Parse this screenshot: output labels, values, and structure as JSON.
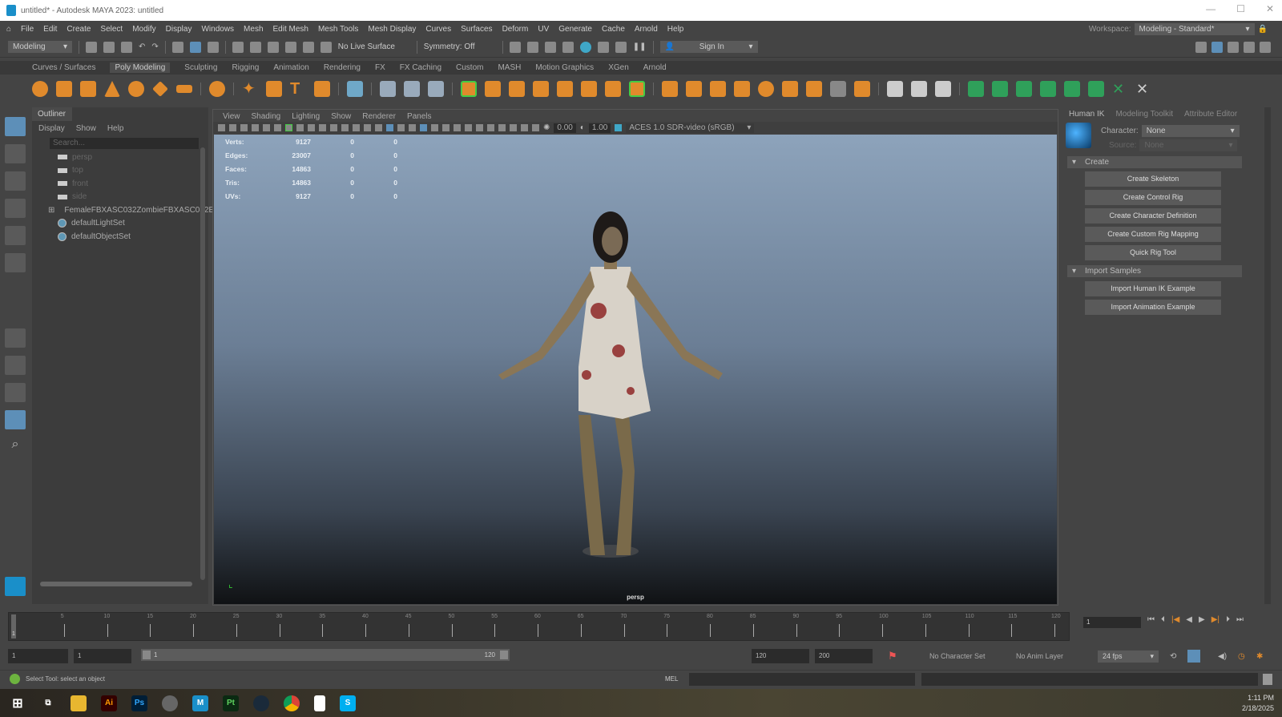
{
  "window": {
    "title": "untitled* - Autodesk MAYA 2023: untitled"
  },
  "menubar": {
    "items": [
      "File",
      "Edit",
      "Create",
      "Select",
      "Modify",
      "Display",
      "Windows",
      "Mesh",
      "Edit Mesh",
      "Mesh Tools",
      "Mesh Display",
      "Curves",
      "Surfaces",
      "Deform",
      "UV",
      "Generate",
      "Cache",
      "Arnold",
      "Help"
    ],
    "workspace_label": "Workspace:",
    "workspace_value": "Modeling - Standard*"
  },
  "statusline": {
    "mode": "Modeling",
    "live_surface": "No Live Surface",
    "symmetry": "Symmetry: Off",
    "sign_in": "Sign In"
  },
  "shelf": {
    "tabs": [
      "Curves / Surfaces",
      "Poly Modeling",
      "Sculpting",
      "Rigging",
      "Animation",
      "Rendering",
      "FX",
      "FX Caching",
      "Custom",
      "MASH",
      "Motion Graphics",
      "XGen",
      "Arnold"
    ],
    "active_tab": "Poly Modeling"
  },
  "outliner": {
    "tab": "Outliner",
    "menu": [
      "Display",
      "Show",
      "Help"
    ],
    "search_placeholder": "Search...",
    "items": [
      {
        "label": "persp",
        "type": "camera"
      },
      {
        "label": "top",
        "type": "camera"
      },
      {
        "label": "front",
        "type": "camera"
      },
      {
        "label": "side",
        "type": "camera"
      },
      {
        "label": "FemaleFBXASC032ZombieFBXASC032E",
        "type": "mesh"
      },
      {
        "label": "defaultLightSet",
        "type": "set"
      },
      {
        "label": "defaultObjectSet",
        "type": "set"
      }
    ]
  },
  "viewport": {
    "menu": [
      "View",
      "Shading",
      "Lighting",
      "Show",
      "Renderer",
      "Panels"
    ],
    "exposure": "0.00",
    "gamma": "1.00",
    "color_space": "ACES 1.0 SDR-video (sRGB)",
    "camera": "persp",
    "hud": [
      {
        "label": "Verts:",
        "value": "9127",
        "sel": "0",
        "comp": "0"
      },
      {
        "label": "Edges:",
        "value": "23007",
        "sel": "0",
        "comp": "0"
      },
      {
        "label": "Faces:",
        "value": "14863",
        "sel": "0",
        "comp": "0"
      },
      {
        "label": "Tris:",
        "value": "14863",
        "sel": "0",
        "comp": "0"
      },
      {
        "label": "UVs:",
        "value": "9127",
        "sel": "0",
        "comp": "0"
      }
    ]
  },
  "right_panel": {
    "tabs": [
      "Human IK",
      "Modeling Toolkit",
      "Attribute Editor"
    ],
    "character_label": "Character:",
    "character_value": "None",
    "source_label": "Source:",
    "source_value": "None",
    "create_section": "Create",
    "create_buttons": [
      "Create Skeleton",
      "Create Control Rig",
      "Create Character Definition",
      "Create Custom Rig Mapping",
      "Quick Rig Tool"
    ],
    "import_section": "Import Samples",
    "import_buttons": [
      "Import Human IK Example",
      "Import Animation Example"
    ]
  },
  "timeline": {
    "ticks": [
      "5",
      "10",
      "15",
      "20",
      "25",
      "30",
      "35",
      "40",
      "45",
      "50",
      "55",
      "60",
      "65",
      "70",
      "75",
      "80",
      "85",
      "90",
      "95",
      "100",
      "105",
      "110",
      "115",
      "120"
    ],
    "current_frame": "1",
    "current_marker": "1"
  },
  "range": {
    "start": "1",
    "anim_start": "1",
    "range_start": "1",
    "range_end": "120",
    "end": "120",
    "anim_end": "200",
    "character_set": "No Character Set",
    "anim_layer": "No Anim Layer",
    "fps": "24 fps"
  },
  "command": {
    "status": "Select Tool: select an object",
    "lang": "MEL"
  },
  "taskbar": {
    "apps": [
      "Ai",
      "Ps",
      "Pt",
      "S"
    ],
    "time": "1:11 PM",
    "date": "2/18/2025"
  }
}
